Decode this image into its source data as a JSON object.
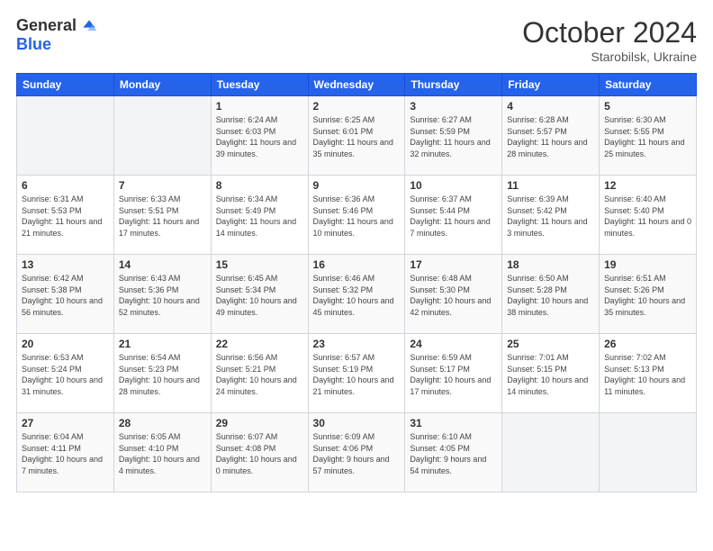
{
  "logo": {
    "general": "General",
    "blue": "Blue"
  },
  "title": {
    "month_year": "October 2024",
    "location": "Starobilsk, Ukraine"
  },
  "days_of_week": [
    "Sunday",
    "Monday",
    "Tuesday",
    "Wednesday",
    "Thursday",
    "Friday",
    "Saturday"
  ],
  "weeks": [
    [
      {
        "day": "",
        "info": ""
      },
      {
        "day": "",
        "info": ""
      },
      {
        "day": "1",
        "info": "Sunrise: 6:24 AM\nSunset: 6:03 PM\nDaylight: 11 hours and 39 minutes."
      },
      {
        "day": "2",
        "info": "Sunrise: 6:25 AM\nSunset: 6:01 PM\nDaylight: 11 hours and 35 minutes."
      },
      {
        "day": "3",
        "info": "Sunrise: 6:27 AM\nSunset: 5:59 PM\nDaylight: 11 hours and 32 minutes."
      },
      {
        "day": "4",
        "info": "Sunrise: 6:28 AM\nSunset: 5:57 PM\nDaylight: 11 hours and 28 minutes."
      },
      {
        "day": "5",
        "info": "Sunrise: 6:30 AM\nSunset: 5:55 PM\nDaylight: 11 hours and 25 minutes."
      }
    ],
    [
      {
        "day": "6",
        "info": "Sunrise: 6:31 AM\nSunset: 5:53 PM\nDaylight: 11 hours and 21 minutes."
      },
      {
        "day": "7",
        "info": "Sunrise: 6:33 AM\nSunset: 5:51 PM\nDaylight: 11 hours and 17 minutes."
      },
      {
        "day": "8",
        "info": "Sunrise: 6:34 AM\nSunset: 5:49 PM\nDaylight: 11 hours and 14 minutes."
      },
      {
        "day": "9",
        "info": "Sunrise: 6:36 AM\nSunset: 5:46 PM\nDaylight: 11 hours and 10 minutes."
      },
      {
        "day": "10",
        "info": "Sunrise: 6:37 AM\nSunset: 5:44 PM\nDaylight: 11 hours and 7 minutes."
      },
      {
        "day": "11",
        "info": "Sunrise: 6:39 AM\nSunset: 5:42 PM\nDaylight: 11 hours and 3 minutes."
      },
      {
        "day": "12",
        "info": "Sunrise: 6:40 AM\nSunset: 5:40 PM\nDaylight: 11 hours and 0 minutes."
      }
    ],
    [
      {
        "day": "13",
        "info": "Sunrise: 6:42 AM\nSunset: 5:38 PM\nDaylight: 10 hours and 56 minutes."
      },
      {
        "day": "14",
        "info": "Sunrise: 6:43 AM\nSunset: 5:36 PM\nDaylight: 10 hours and 52 minutes."
      },
      {
        "day": "15",
        "info": "Sunrise: 6:45 AM\nSunset: 5:34 PM\nDaylight: 10 hours and 49 minutes."
      },
      {
        "day": "16",
        "info": "Sunrise: 6:46 AM\nSunset: 5:32 PM\nDaylight: 10 hours and 45 minutes."
      },
      {
        "day": "17",
        "info": "Sunrise: 6:48 AM\nSunset: 5:30 PM\nDaylight: 10 hours and 42 minutes."
      },
      {
        "day": "18",
        "info": "Sunrise: 6:50 AM\nSunset: 5:28 PM\nDaylight: 10 hours and 38 minutes."
      },
      {
        "day": "19",
        "info": "Sunrise: 6:51 AM\nSunset: 5:26 PM\nDaylight: 10 hours and 35 minutes."
      }
    ],
    [
      {
        "day": "20",
        "info": "Sunrise: 6:53 AM\nSunset: 5:24 PM\nDaylight: 10 hours and 31 minutes."
      },
      {
        "day": "21",
        "info": "Sunrise: 6:54 AM\nSunset: 5:23 PM\nDaylight: 10 hours and 28 minutes."
      },
      {
        "day": "22",
        "info": "Sunrise: 6:56 AM\nSunset: 5:21 PM\nDaylight: 10 hours and 24 minutes."
      },
      {
        "day": "23",
        "info": "Sunrise: 6:57 AM\nSunset: 5:19 PM\nDaylight: 10 hours and 21 minutes."
      },
      {
        "day": "24",
        "info": "Sunrise: 6:59 AM\nSunset: 5:17 PM\nDaylight: 10 hours and 17 minutes."
      },
      {
        "day": "25",
        "info": "Sunrise: 7:01 AM\nSunset: 5:15 PM\nDaylight: 10 hours and 14 minutes."
      },
      {
        "day": "26",
        "info": "Sunrise: 7:02 AM\nSunset: 5:13 PM\nDaylight: 10 hours and 11 minutes."
      }
    ],
    [
      {
        "day": "27",
        "info": "Sunrise: 6:04 AM\nSunset: 4:11 PM\nDaylight: 10 hours and 7 minutes."
      },
      {
        "day": "28",
        "info": "Sunrise: 6:05 AM\nSunset: 4:10 PM\nDaylight: 10 hours and 4 minutes."
      },
      {
        "day": "29",
        "info": "Sunrise: 6:07 AM\nSunset: 4:08 PM\nDaylight: 10 hours and 0 minutes."
      },
      {
        "day": "30",
        "info": "Sunrise: 6:09 AM\nSunset: 4:06 PM\nDaylight: 9 hours and 57 minutes."
      },
      {
        "day": "31",
        "info": "Sunrise: 6:10 AM\nSunset: 4:05 PM\nDaylight: 9 hours and 54 minutes."
      },
      {
        "day": "",
        "info": ""
      },
      {
        "day": "",
        "info": ""
      }
    ]
  ]
}
